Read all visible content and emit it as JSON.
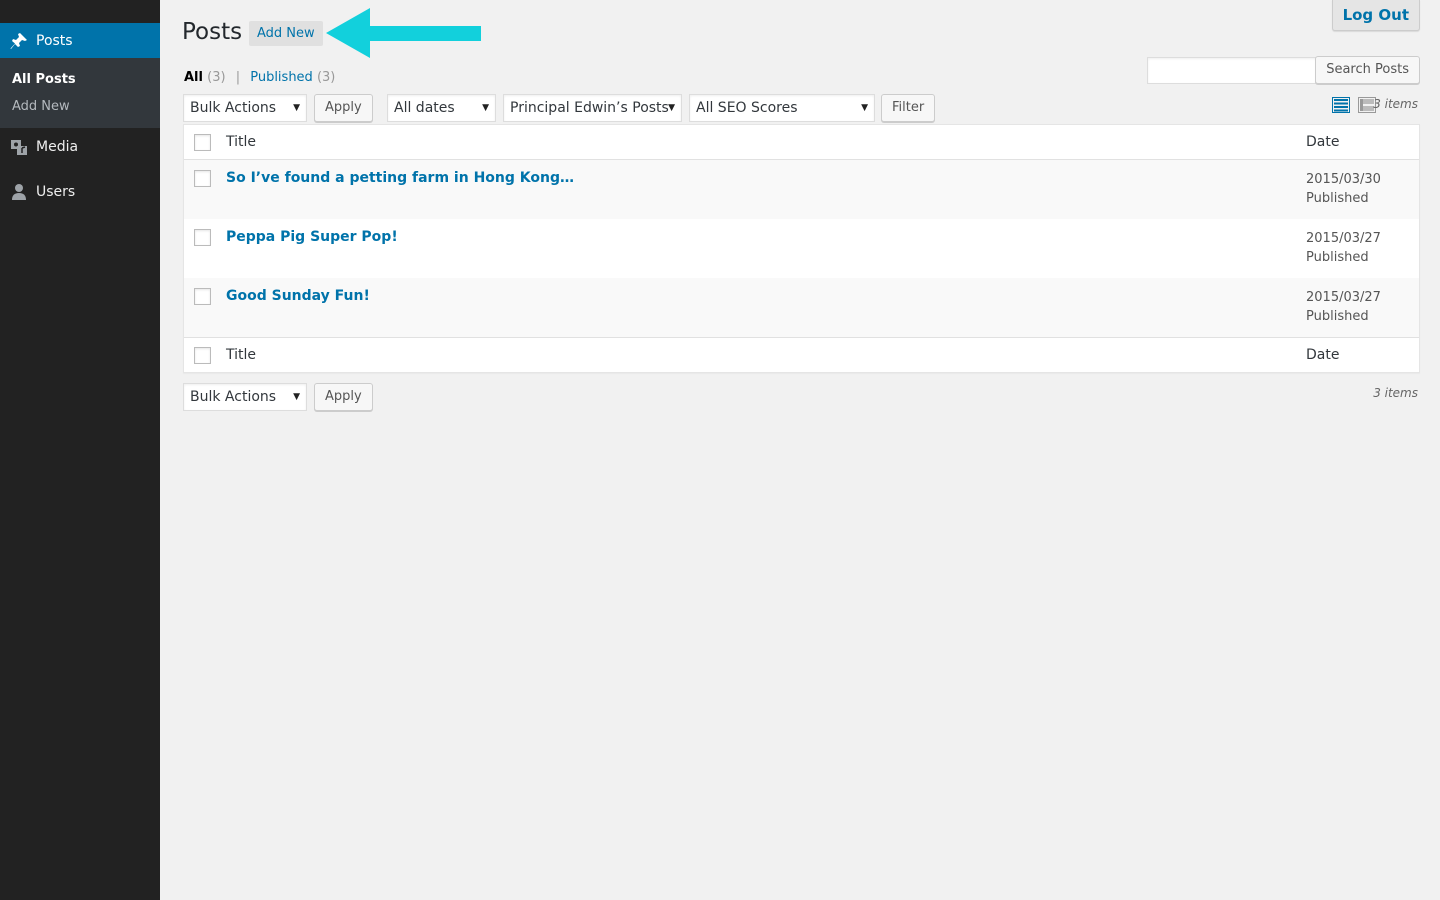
{
  "sidebar": {
    "posts_label": "Posts",
    "submenu": [
      "All Posts",
      "Add New"
    ],
    "media_label": "Media",
    "users_label": "Users"
  },
  "header": {
    "title": "Posts",
    "add_new": "Add New",
    "logout": "Log Out"
  },
  "filters": {
    "all_label": "All",
    "all_count": "(3)",
    "published_label": "Published",
    "published_count": "(3)"
  },
  "search": {
    "value": "",
    "button": "Search Posts"
  },
  "toolbar": {
    "bulk_actions": "Bulk Actions",
    "apply": "Apply",
    "dates": "All dates",
    "author": "Principal Edwin’s Posts",
    "seo": "All SEO Scores",
    "filter": "Filter",
    "items_count": "3 items"
  },
  "table": {
    "col_title": "Title",
    "col_date": "Date",
    "rows": [
      {
        "title": "So I’ve found a petting farm in Hong Kong…",
        "date": "2015/03/30",
        "status": "Published"
      },
      {
        "title": "Peppa Pig Super Pop!",
        "date": "2015/03/27",
        "status": "Published"
      },
      {
        "title": "Good Sunday Fun!",
        "date": "2015/03/27",
        "status": "Published"
      }
    ]
  },
  "colors": {
    "accent": "#0073aa",
    "sidebar_bg": "#222222",
    "arrow": "#12d0dc"
  },
  "icons": {
    "posts": "pushpin-icon",
    "media": "media-icon",
    "users": "user-icon",
    "list_view": "list-view-icon",
    "excerpt_view": "excerpt-view-icon",
    "dropdown": "caret-down-icon"
  }
}
